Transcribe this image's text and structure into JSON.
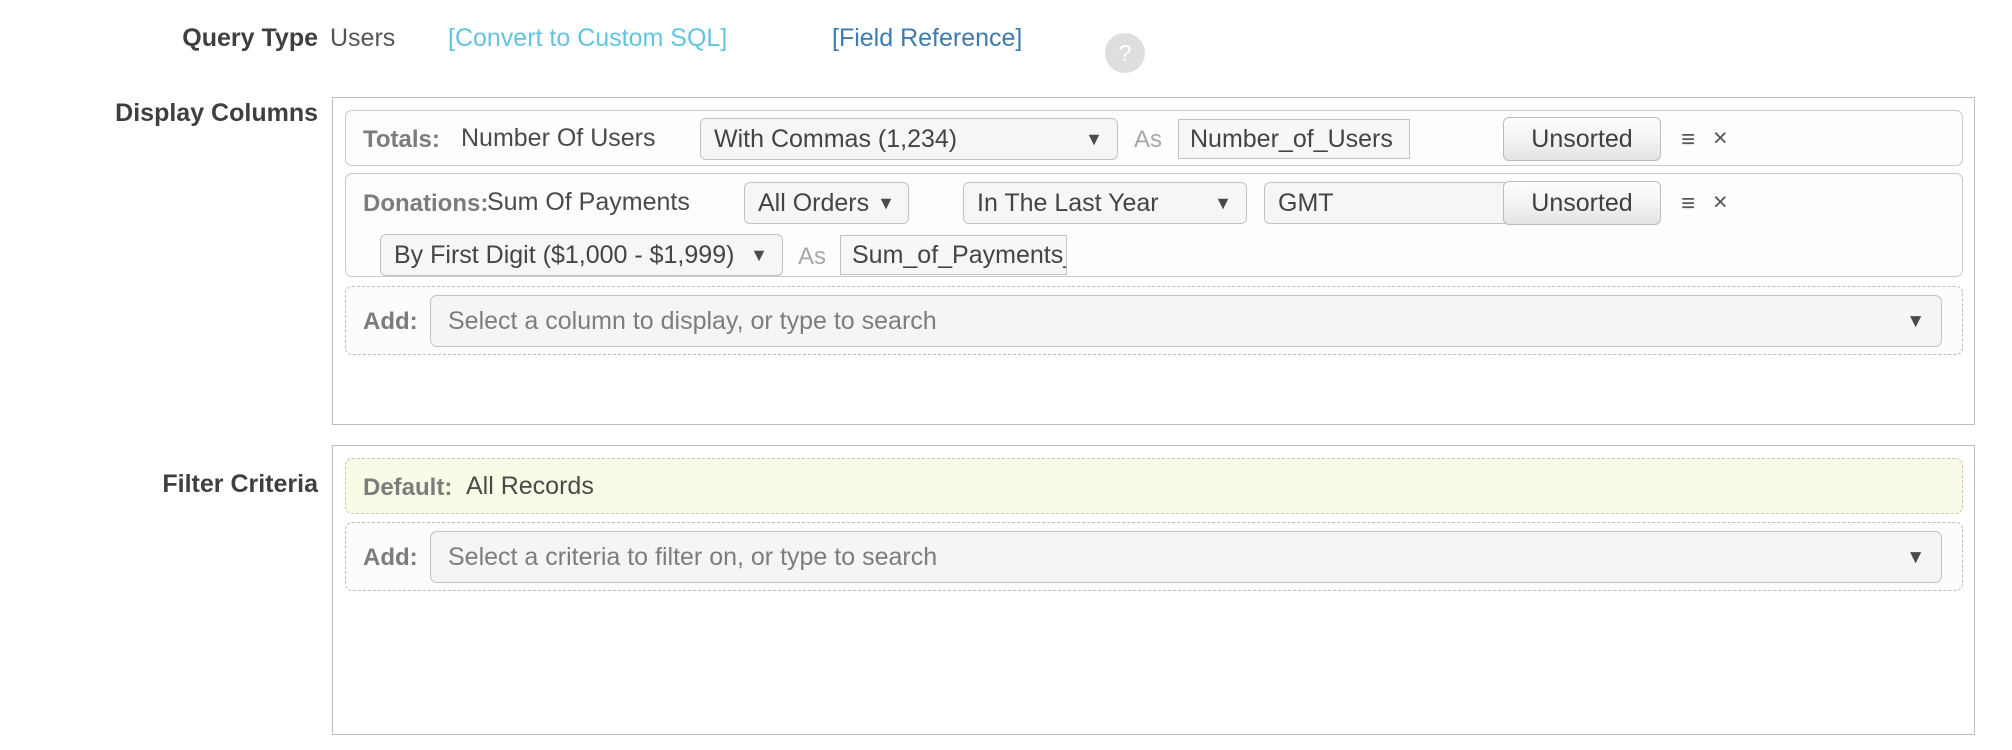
{
  "query_type": {
    "label": "Query Type",
    "value": "Users",
    "convert_link": "[Convert to Custom SQL]",
    "field_reference_link": "[Field Reference]",
    "help_icon": "?"
  },
  "display_columns": {
    "label": "Display Columns",
    "rows": [
      {
        "tag": "Totals:",
        "field": "Number Of Users",
        "format_select": "With Commas (1,234)",
        "as_label": "As",
        "alias": "Number_of_Users",
        "sort_button": "Unsorted",
        "menu_icon": "hamburger-icon",
        "close_icon": "×"
      },
      {
        "tag": "Donations:",
        "field": "Sum Of Payments",
        "scope_select": "All Orders",
        "range_select": "In The Last Year",
        "timezone_select": "GMT",
        "bucket_select": "By First Digit ($1,000 - $1,999)",
        "as_label": "As",
        "alias": "Sum_of_Payments_",
        "sort_button": "Unsorted",
        "menu_icon": "hamburger-icon",
        "close_icon": "×"
      }
    ],
    "add_row": {
      "tag": "Add:",
      "placeholder": "Select a column to display, or type to search"
    }
  },
  "filter_criteria": {
    "label": "Filter Criteria",
    "default_row": {
      "tag": "Default:",
      "value": "All Records"
    },
    "add_row": {
      "tag": "Add:",
      "placeholder": "Select a criteria to filter on, or type to search"
    }
  },
  "glyphs": {
    "caret_down": "▼",
    "hamburger": "≡",
    "close": "×"
  },
  "colors": {
    "link_light_blue": "#64c3e0",
    "link_blue": "#3d7ab0",
    "default_row_bg": "#fafbe6",
    "panel_border": "#c0c0c0"
  }
}
